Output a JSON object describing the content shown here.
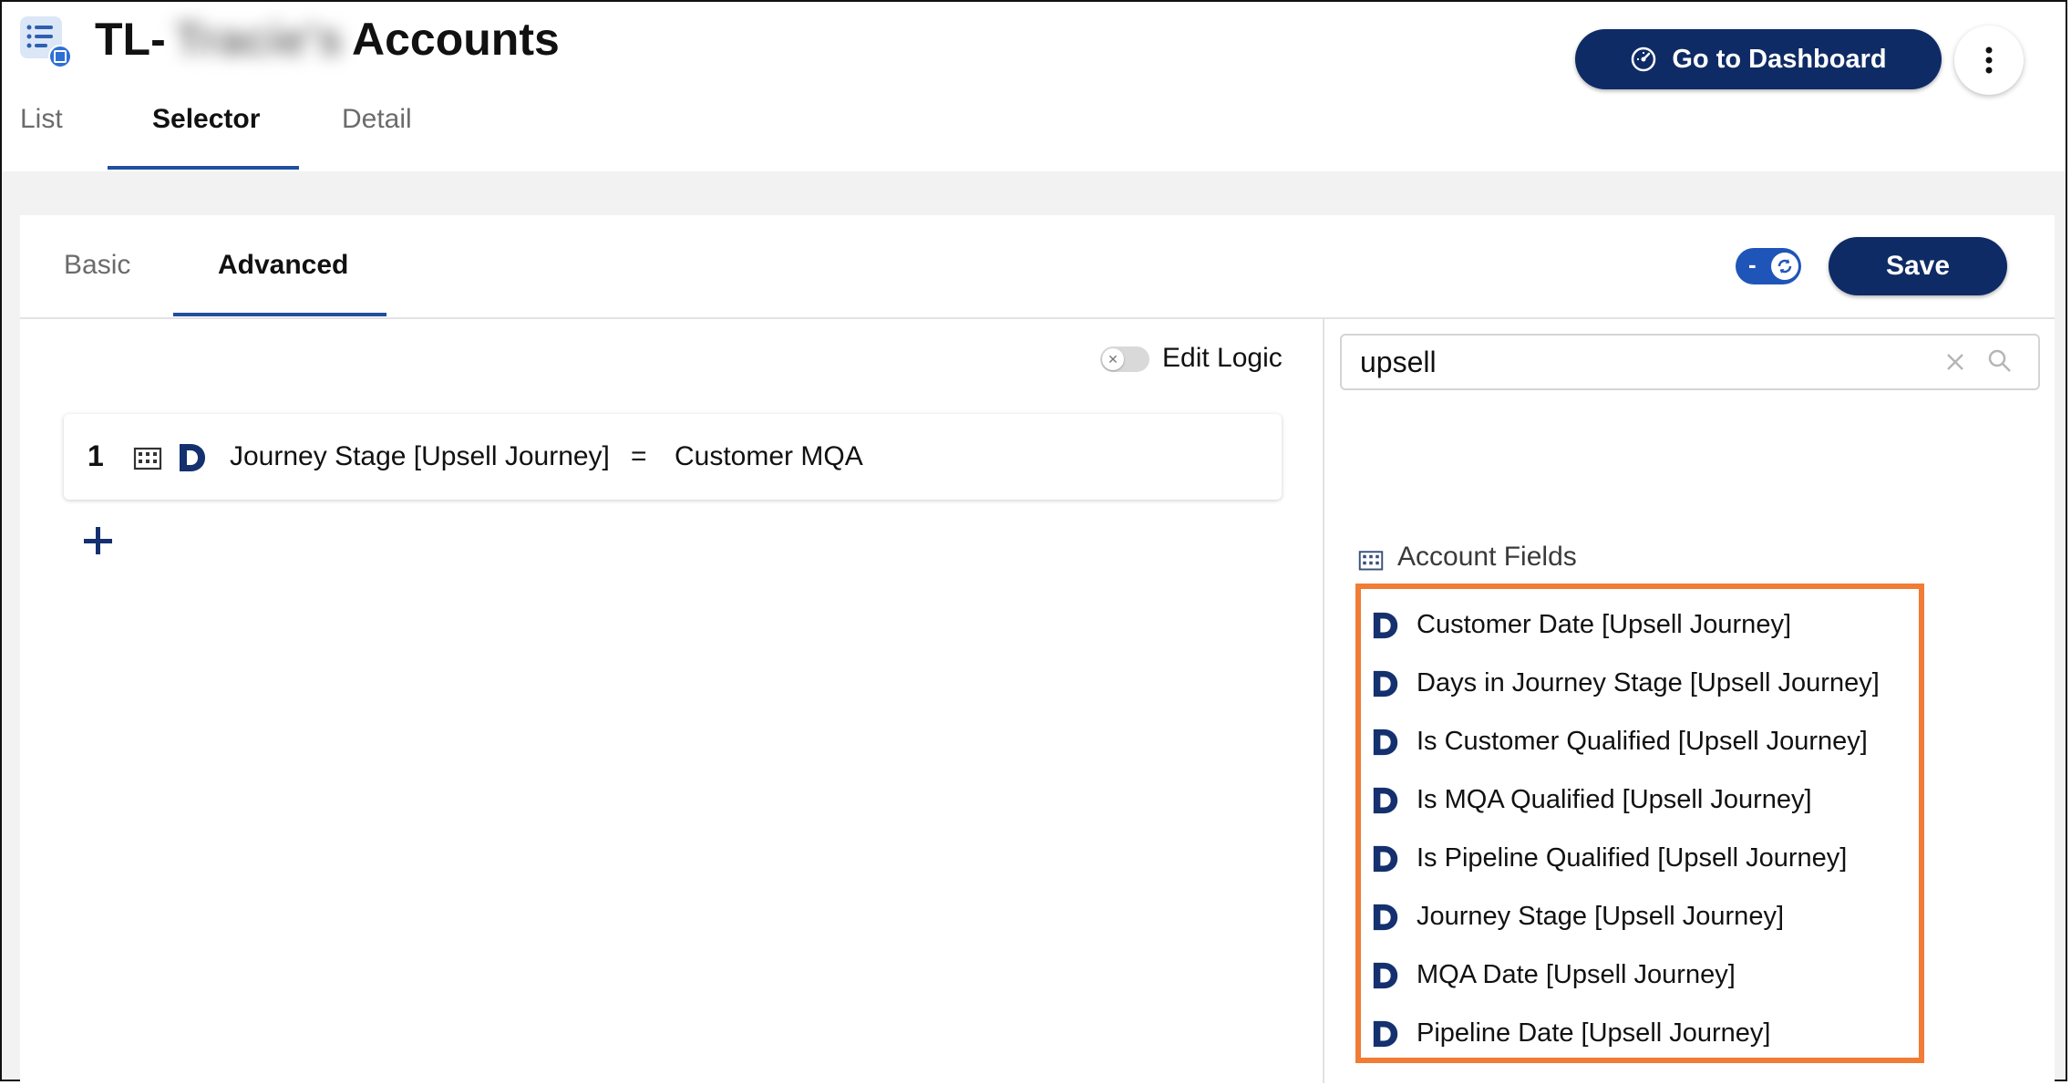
{
  "header": {
    "title_prefix": "TL-",
    "title_blurred": "Tracie's",
    "title_suffix": "Accounts",
    "dashboard_button": "Go to Dashboard"
  },
  "top_tabs": [
    {
      "label": "List",
      "active": false
    },
    {
      "label": "Selector",
      "active": true
    },
    {
      "label": "Detail",
      "active": false
    }
  ],
  "sub_tabs": [
    {
      "label": "Basic",
      "active": false
    },
    {
      "label": "Advanced",
      "active": true
    }
  ],
  "toolbar": {
    "toggle_label": "-",
    "save_label": "Save"
  },
  "editor": {
    "edit_logic_label": "Edit Logic",
    "edit_logic_on": false,
    "rules": [
      {
        "number": "1",
        "field": "Journey Stage [Upsell Journey]",
        "operator": "=",
        "value": "Customer MQA"
      }
    ]
  },
  "field_panel": {
    "search_value": "upsell",
    "section_label": "Account Fields",
    "fields": [
      "Customer Date [Upsell Journey]",
      "Days in Journey Stage [Upsell Journey]",
      "Is Customer Qualified [Upsell Journey]",
      "Is MQA Qualified [Upsell Journey]",
      "Is Pipeline Qualified [Upsell Journey]",
      "Journey Stage [Upsell Journey]",
      "MQA Date [Upsell Journey]",
      "Pipeline Date [Upsell Journey]"
    ]
  },
  "colors": {
    "primary_navy": "#0f2b66",
    "tab_underline": "#1f4fa0",
    "toggle_blue": "#1f55b8",
    "highlight_orange": "#f07c35",
    "background_gray": "#f2f2f2"
  },
  "icons": {
    "app": "list-icon",
    "dashboard": "speedometer-icon",
    "more": "kebab-menu-icon",
    "sync": "refresh-icon",
    "entity": "building-icon",
    "field_source": "d-logo-icon",
    "add": "plus-icon",
    "clear": "close-icon",
    "search": "search-icon"
  }
}
